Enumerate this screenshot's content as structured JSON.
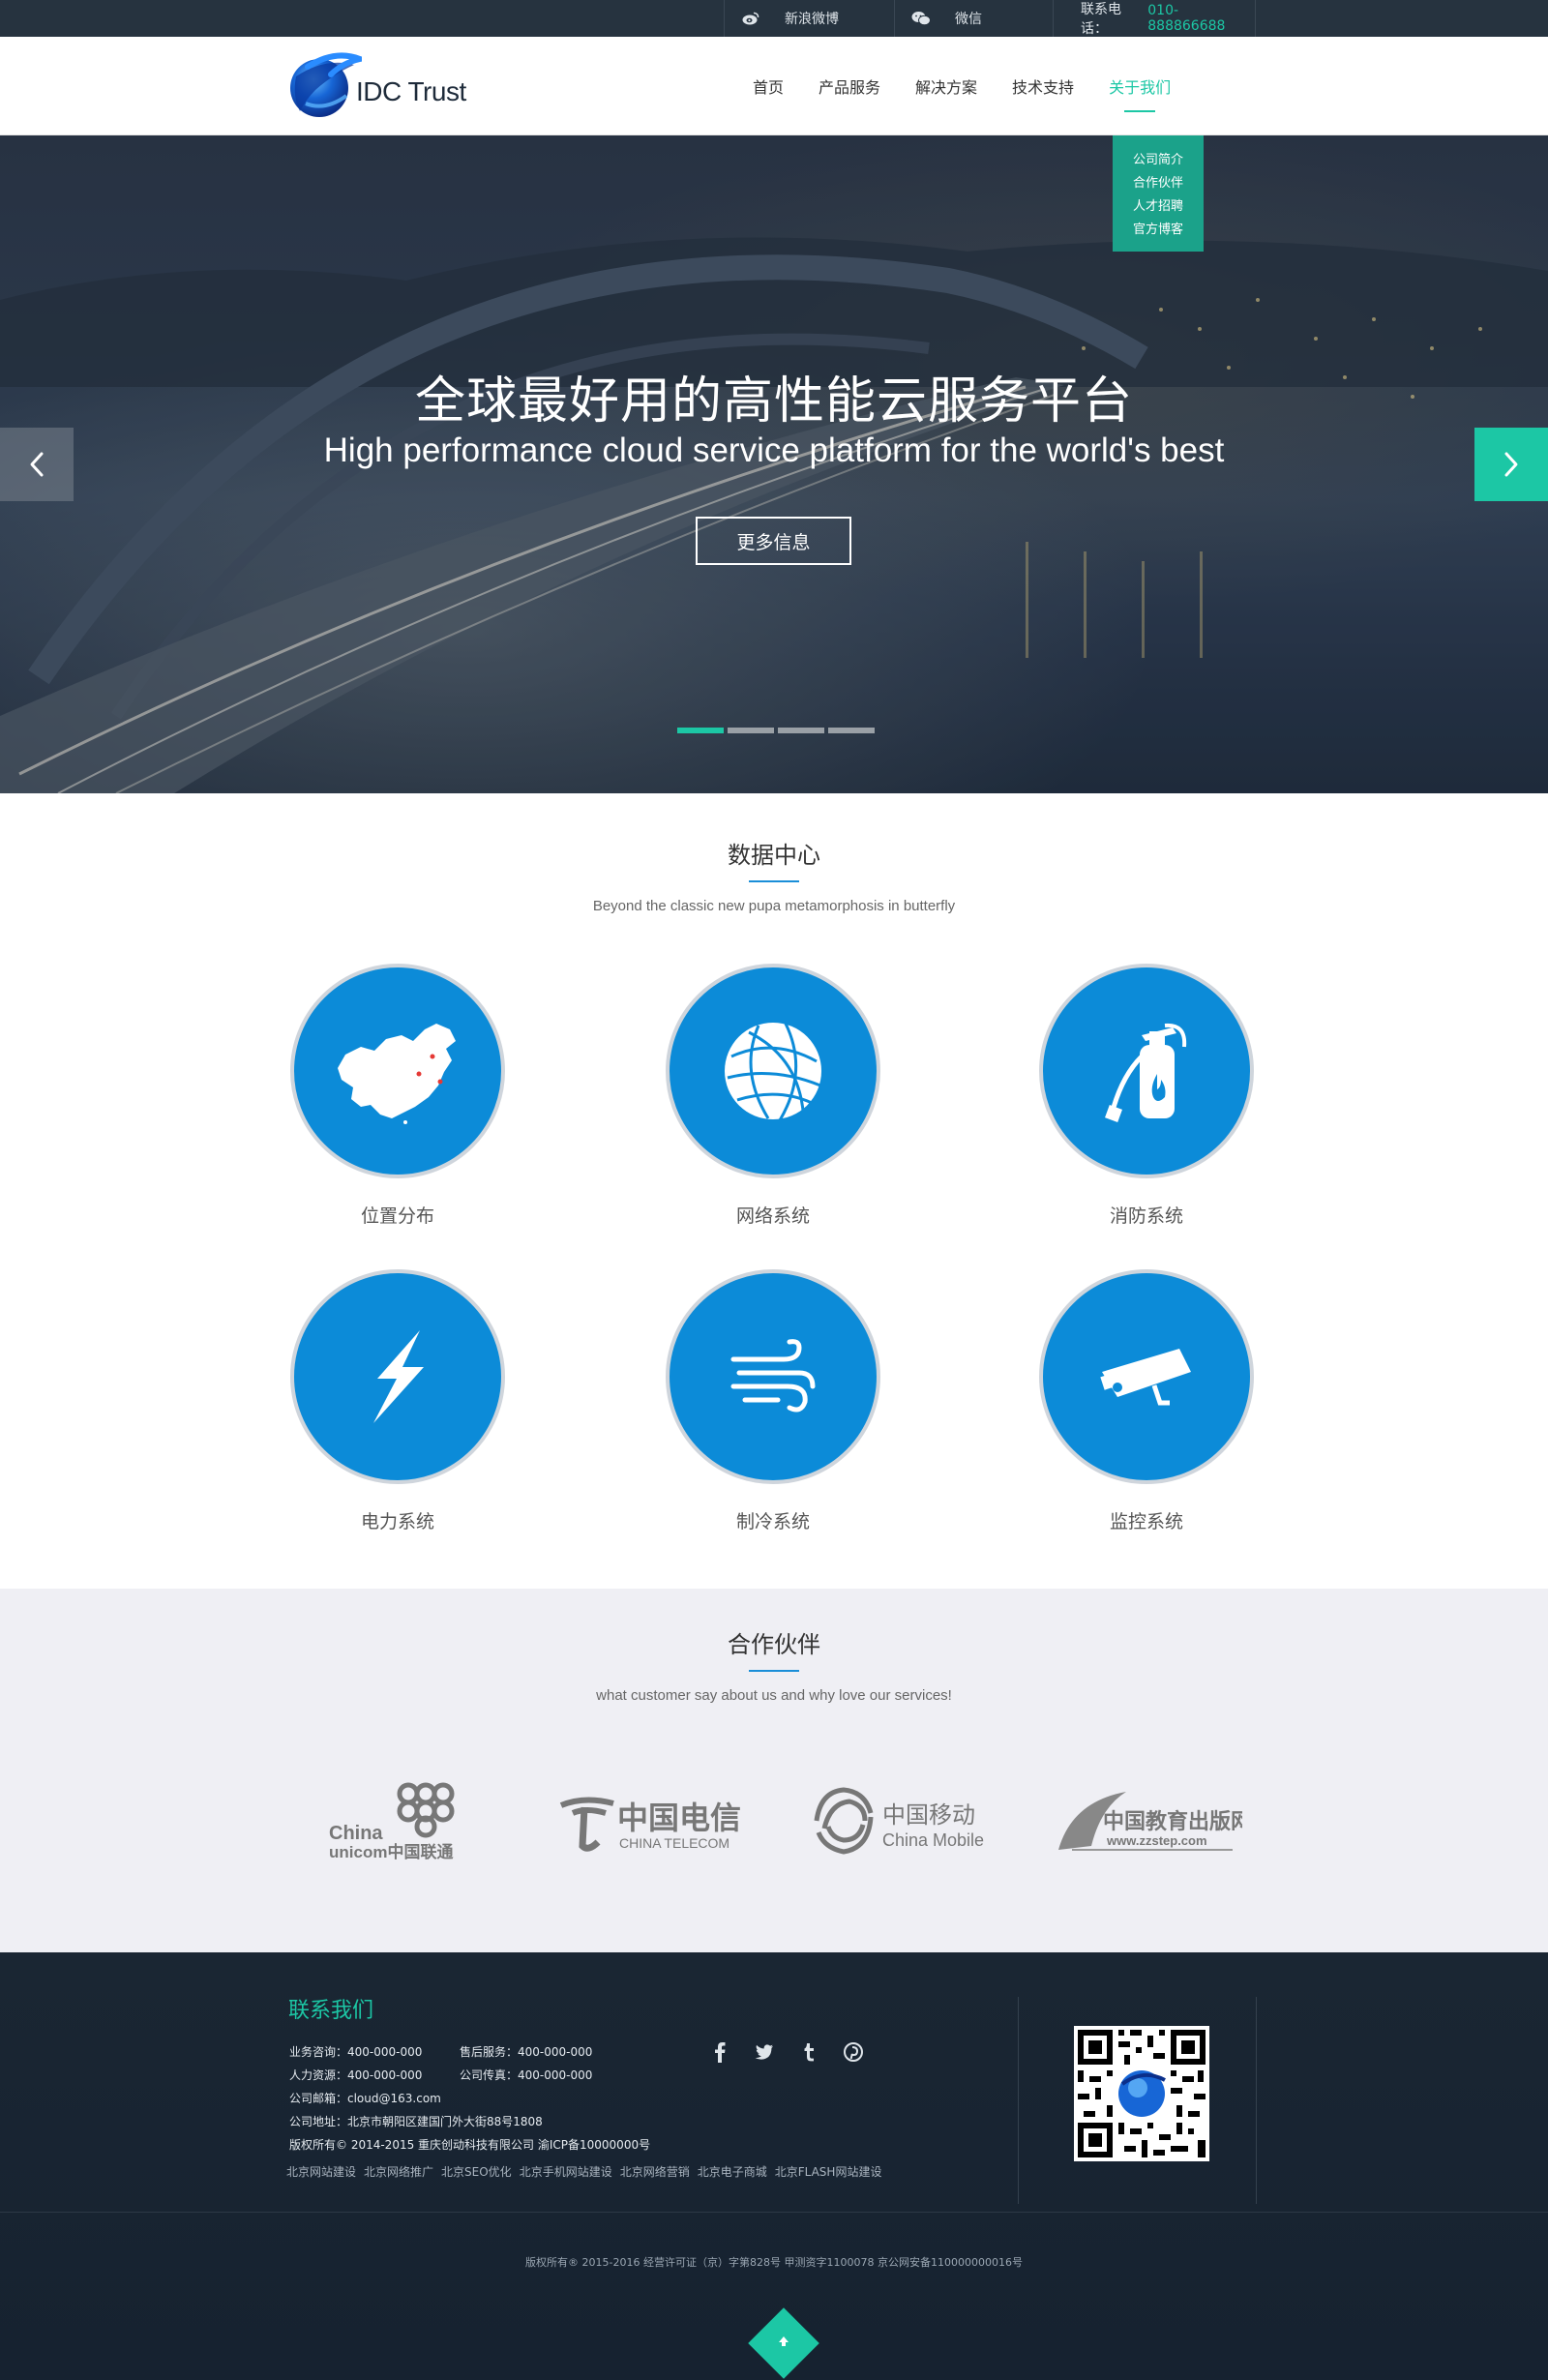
{
  "topbar": {
    "weibo_icon": "weibo-icon",
    "weibo_label": "新浪微博",
    "wechat_icon": "wechat-icon",
    "wechat_label": "微信",
    "phone_label": "联系电话：",
    "phone_number": "010-888866688"
  },
  "header": {
    "logo_text": "IDC Trust",
    "nav": [
      {
        "label": "首页"
      },
      {
        "label": "产品服务"
      },
      {
        "label": "解决方案"
      },
      {
        "label": "技术支持"
      },
      {
        "label": "关于我们",
        "active": true
      }
    ],
    "dropdown": [
      "公司简介",
      "合作伙伴",
      "人才招聘",
      "官方博客"
    ]
  },
  "hero": {
    "headline": "全球最好用的高性能云服务平台",
    "subline": "High performance cloud service platform for the world's best",
    "button_label": "更多信息",
    "prev_icon": "chevron-left-icon",
    "next_icon": "chevron-right-icon",
    "slides": 4,
    "active_slide": 1
  },
  "datacenter": {
    "title": "数据中心",
    "subtitle": "Beyond the classic new pupa metamorphosis in butterfly",
    "items": [
      {
        "label": "位置分布",
        "icon": "china-map-icon"
      },
      {
        "label": "网络系统",
        "icon": "globe-network-icon"
      },
      {
        "label": "消防系统",
        "icon": "fire-extinguisher-icon"
      },
      {
        "label": "电力系统",
        "icon": "lightning-icon"
      },
      {
        "label": "制冷系统",
        "icon": "wind-icon"
      },
      {
        "label": "监控系统",
        "icon": "security-camera-icon"
      }
    ]
  },
  "partners": {
    "title": "合作伙伴",
    "subtitle": "what customer say about us and why love our services!",
    "logos": [
      {
        "name": "China Unicom",
        "line1": "China",
        "line2": "unicom中国联通"
      },
      {
        "name": "China Telecom",
        "line1": "中国电信",
        "line2": "CHINA TELECOM"
      },
      {
        "name": "China Mobile",
        "line1": "中国移动",
        "line2": "China Mobile"
      },
      {
        "name": "zzstep",
        "line1": "中国教育出版网",
        "line2": "www.zzstep.com"
      }
    ]
  },
  "footer": {
    "contact_title": "联系我们",
    "info": [
      "业务咨询：400-000-000",
      "售后服务：400-000-000",
      "人力资源：400-000-000",
      "公司传真：400-000-000",
      "公司邮箱：cloud@163.com",
      "公司地址：北京市朝阳区建国门外大街88号1808",
      "版权所有© 2014-2015  重庆创动科技有限公司  渝ICP备10000000号"
    ],
    "links": [
      "北京网站建设",
      "北京网络推广",
      "北京SEO优化",
      "北京手机网站建设",
      "北京网络营销",
      "北京电子商城",
      "北京FLASH网站建设"
    ],
    "social": [
      "facebook-icon",
      "twitter-icon",
      "tumblr-icon",
      "pinterest-icon"
    ],
    "copyright": "版权所有® 2015-2016 经营许可证（京）字第828号 甲测资字1100078 京公网安备110000000016号",
    "back_to_top_icon": "arrow-up-icon",
    "colors": {
      "accent": "#1cc7a5",
      "blue": "#0c8bd8",
      "dark": "#1a2633"
    }
  }
}
